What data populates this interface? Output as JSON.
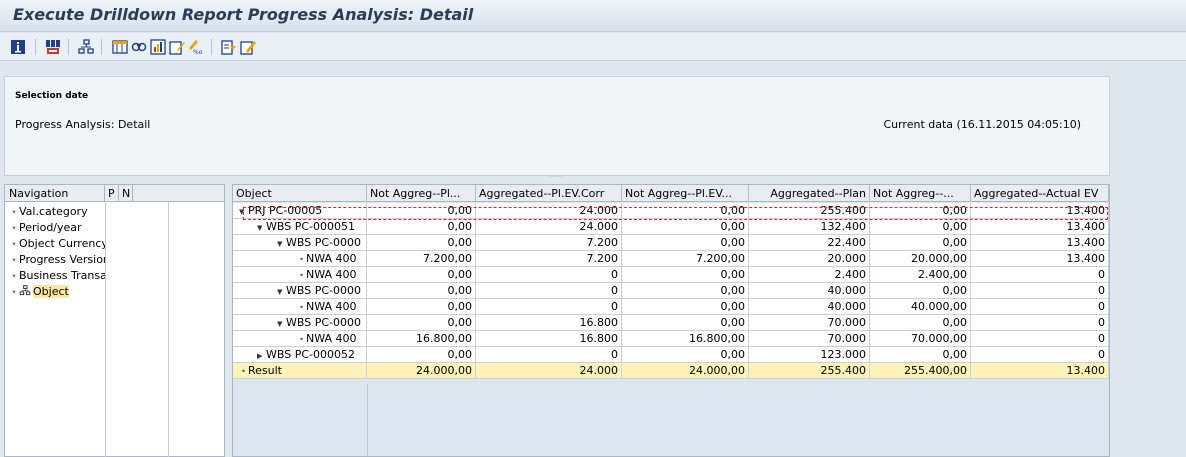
{
  "window": {
    "title": "Execute Drilldown Report Progress Analysis: Detail"
  },
  "toolbar": {
    "icons": [
      "info-icon",
      "filter-icon",
      "hierarchy-icon",
      "layout-icon",
      "find-icon",
      "graphic-icon",
      "edit-icon",
      "display-text-icon",
      "export-icon",
      "change-icon"
    ],
    "accent_color": "#1f3f8a"
  },
  "header": {
    "selection_date_label": "Selection date",
    "report_name": "Progress Analysis: Detail",
    "current_data": "Current data (16.11.2015 04:05:10)",
    "splitter": "....."
  },
  "navigation": {
    "columns": [
      "Navigation",
      "P",
      "N"
    ],
    "items": [
      {
        "label": "Val.category"
      },
      {
        "label": "Period/year"
      },
      {
        "label": "Object Currency"
      },
      {
        "label": "Progress Version"
      },
      {
        "label": "Business Transaction"
      },
      {
        "label": "Object",
        "active": true
      }
    ]
  },
  "grid": {
    "columns": [
      "Object",
      "Not Aggreg--Pl...",
      "Aggregated--Pl.EV.Corr",
      "Not Aggreg--Pl.EV...",
      "Aggregated--Plan",
      "Not Aggreg--...",
      "Aggregated--Actual EV"
    ],
    "rows": [
      {
        "object": "PRJ PC-00005",
        "indent": 0,
        "node": "expanded",
        "values": [
          "0,00",
          "24.000",
          "0,00",
          "255.400",
          "0,00",
          "13.400"
        ]
      },
      {
        "object": "WBS PC-000051",
        "indent": 1,
        "node": "expanded",
        "values": [
          "0,00",
          "24.000",
          "0,00",
          "132.400",
          "0,00",
          "13.400"
        ]
      },
      {
        "object": "WBS PC-0000",
        "indent": 2,
        "node": "expanded",
        "values": [
          "0,00",
          "7.200",
          "0,00",
          "22.400",
          "0,00",
          "13.400"
        ]
      },
      {
        "object": "NWA 400",
        "indent": 3,
        "node": "leaf",
        "values": [
          "7.200,00",
          "7.200",
          "7.200,00",
          "20.000",
          "20.000,00",
          "13.400"
        ]
      },
      {
        "object": "NWA 400",
        "indent": 3,
        "node": "leaf",
        "values": [
          "0,00",
          "0",
          "0,00",
          "2.400",
          "2.400,00",
          "0"
        ]
      },
      {
        "object": "WBS PC-0000",
        "indent": 2,
        "node": "expanded",
        "values": [
          "0,00",
          "0",
          "0,00",
          "40.000",
          "0,00",
          "0"
        ]
      },
      {
        "object": "NWA 400",
        "indent": 3,
        "node": "leaf",
        "values": [
          "0,00",
          "0",
          "0,00",
          "40.000",
          "40.000,00",
          "0"
        ]
      },
      {
        "object": "WBS PC-0000",
        "indent": 2,
        "node": "expanded",
        "values": [
          "0,00",
          "16.800",
          "0,00",
          "70.000",
          "0,00",
          "0"
        ]
      },
      {
        "object": "NWA 400",
        "indent": 3,
        "node": "leaf",
        "values": [
          "16.800,00",
          "16.800",
          "16.800,00",
          "70.000",
          "70.000,00",
          "0"
        ]
      },
      {
        "object": "WBS PC-000052",
        "indent": 1,
        "node": "collapsed",
        "values": [
          "0,00",
          "0",
          "0,00",
          "123.000",
          "0,00",
          "0"
        ]
      }
    ],
    "result": {
      "object": "Result",
      "values": [
        "24.000,00",
        "24.000",
        "24.000,00",
        "255.400",
        "255.400,00",
        "13.400"
      ]
    },
    "result_color": "#fbf3b8"
  }
}
